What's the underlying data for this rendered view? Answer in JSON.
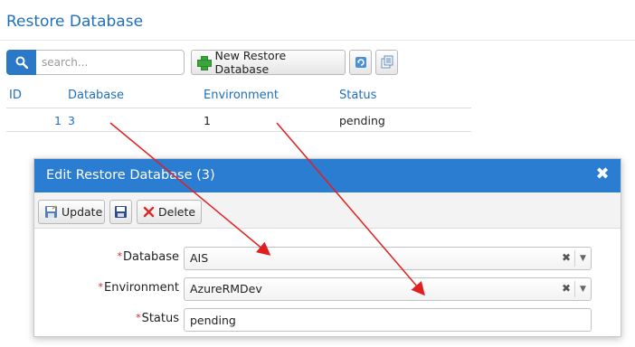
{
  "page": {
    "title": "Restore Database"
  },
  "toolbar": {
    "search_placeholder": "search...",
    "search_value": "",
    "new_button_label": "New Restore Database",
    "icons": [
      "search-icon",
      "plus-icon",
      "refresh-icon",
      "export-icon"
    ]
  },
  "grid": {
    "columns": [
      "ID",
      "Database",
      "Environment",
      "Status"
    ],
    "rows": [
      {
        "id": "1",
        "database": "3",
        "environment": "1",
        "status": "pending"
      }
    ]
  },
  "dialog": {
    "title": "Edit Restore Database (3)",
    "close_icon": "close-icon",
    "buttons": {
      "update": "Update",
      "delete": "Delete"
    },
    "fields": {
      "database": {
        "label": "Database",
        "value": "AIS",
        "required": "*"
      },
      "environment": {
        "label": "Environment",
        "value": "AzureRMDev",
        "required": "*"
      },
      "status": {
        "label": "Status",
        "value": "pending",
        "required": "*"
      }
    }
  },
  "colors": {
    "accent": "#2a7dd0",
    "link": "#1f6fbf",
    "annotation_arrow": "#e02020",
    "required_mark": "#dd2222"
  }
}
